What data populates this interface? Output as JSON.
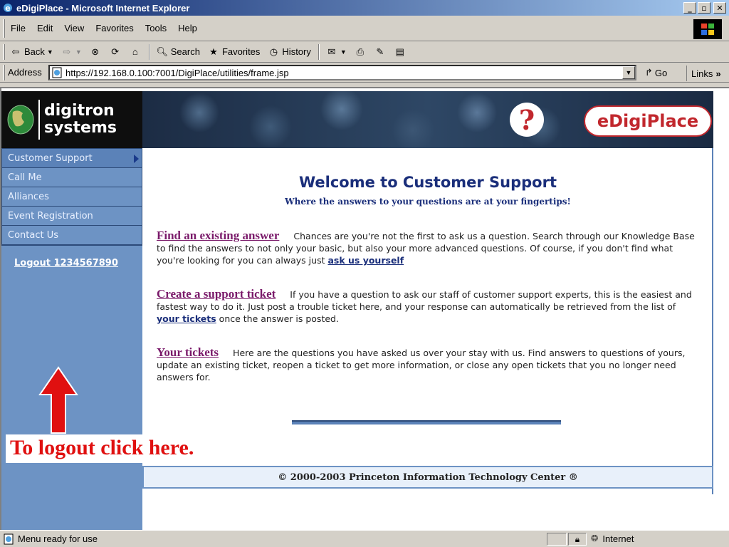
{
  "window": {
    "title": "eDigiPlace - Microsoft Internet Explorer",
    "minimize_label": "_",
    "maximize_label": "̅❐",
    "close_label": "×"
  },
  "menu": [
    "File",
    "Edit",
    "View",
    "Favorites",
    "Tools",
    "Help"
  ],
  "toolbar": {
    "back_label": "Back",
    "search_label": "Search",
    "favorites_label": "Favorites",
    "history_label": "History"
  },
  "address": {
    "label": "Address",
    "url": "https://192.168.0.100:7001/DigiPlace/utilities/frame.jsp",
    "go_label": "Go",
    "links_label": "Links"
  },
  "banner": {
    "logo_line1": "digitron",
    "logo_line2": "systems",
    "brand": "eDigiPlace"
  },
  "sidebar": {
    "items": [
      {
        "label": "Customer Support"
      },
      {
        "label": "Call Me"
      },
      {
        "label": "Alliances"
      },
      {
        "label": "Event Registration"
      },
      {
        "label": "Contact Us"
      }
    ],
    "logout": "Logout 1234567890"
  },
  "content": {
    "title": "Welcome to Customer Support",
    "subtitle": "Where the answers to your questions are at your fingertips!",
    "sections": [
      {
        "heading": "Find an existing answer",
        "text": "Chances are you're not the first to ask us a question. Search through our Knowledge Base to find the answers to not only your basic, but also your more advanced questions. Of course, if you don't find what you're looking for you can always just ",
        "link": "ask us yourself",
        "after": ""
      },
      {
        "heading": "Create a support ticket",
        "text": "If you have a question to ask our staff of customer support experts, this is the easiest and fastest way to do it. Just post a trouble ticket here, and your response can automatically be retrieved from the list of ",
        "link": "your tickets",
        "after": " once the answer is posted."
      },
      {
        "heading": "Your tickets",
        "text": "Here are the questions you have asked us over your stay with us. Find answers to questions of yours, update an existing ticket, reopen a ticket to get more information, or close any open tickets that you no longer need answers for.",
        "link": "",
        "after": ""
      }
    ],
    "footer": "© 2000-2003 Princeton Information Technology Center ®"
  },
  "annotation": {
    "label": "To logout click here."
  },
  "status": {
    "text": "Menu ready for use",
    "zone": "Internet"
  }
}
